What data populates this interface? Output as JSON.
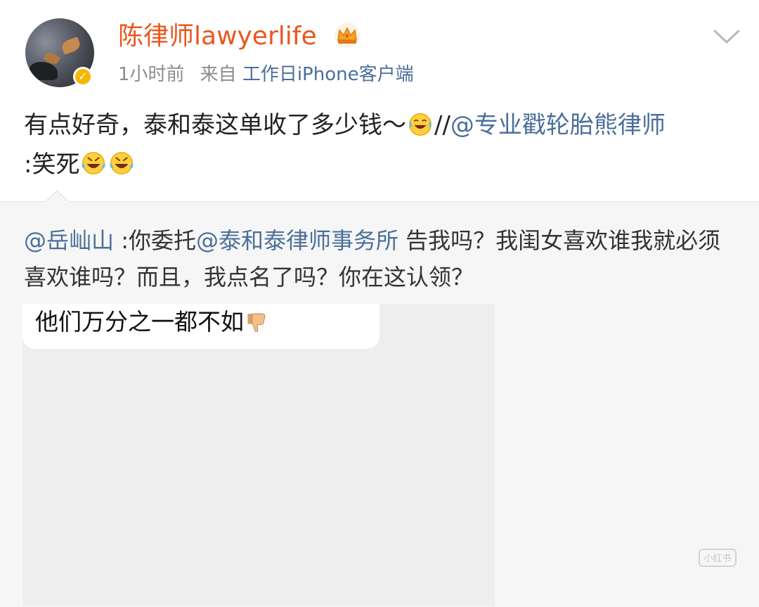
{
  "post_header": {
    "username": "陈律师lawyerlife",
    "time": "1小时前",
    "source_prefix": "来自",
    "source": "工作日iPhone客户端"
  },
  "post": {
    "text_part1": "有点好奇，泰和泰这单收了多少钱～",
    "separator": "//",
    "mention": "@专业戳轮胎熊律师",
    "text_part2": ":笑死"
  },
  "repost": {
    "author_mention": "@岳屾山",
    "text_part1": " :你委托",
    "mention": "@泰和泰律师事务所",
    "text_part2": " 告我吗？我闺女喜欢谁我就必须喜欢谁吗？而且，我点名了吗？你在这认领？"
  },
  "image": {
    "bubble_text": "他们万分之一都不如"
  },
  "watermark": {
    "label": "小红书"
  },
  "colors": {
    "username": "#e8571f",
    "link": "#4b6f99",
    "meta": "#8c8c8c",
    "verified_badge": "#f6b800",
    "repost_bg": "#f6f6f6"
  },
  "icons": [
    "avatar",
    "verified-badge-icon",
    "crown-icon",
    "chevron-down-icon",
    "laughing-tears-emoji",
    "rolling-laugh-emoji",
    "thumbs-down-emoji"
  ]
}
